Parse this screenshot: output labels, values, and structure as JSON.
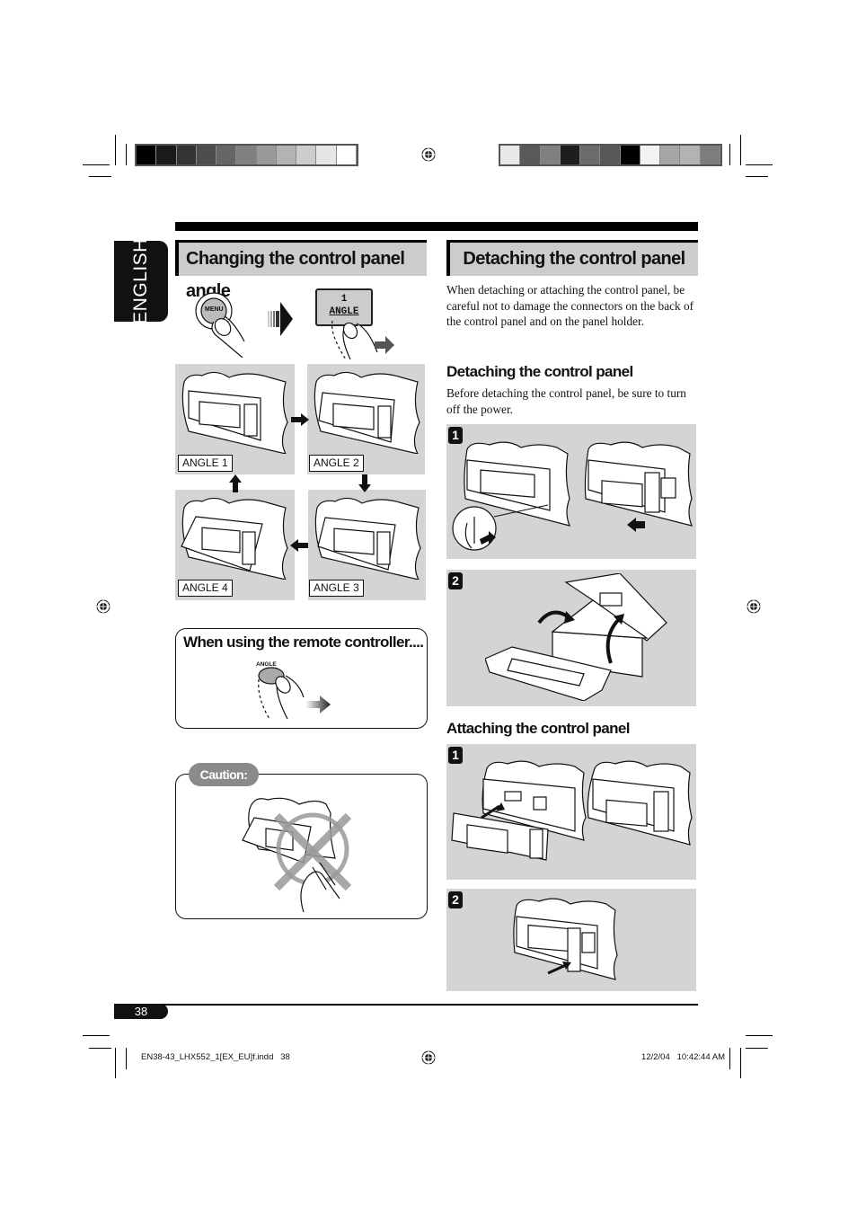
{
  "language_tab": "ENGLISH",
  "left_section": {
    "title": "Changing the control panel angle",
    "menu_button_label": "MENU",
    "display_number": "1",
    "display_label": "ANGLE",
    "angle_labels": [
      "ANGLE 1",
      "ANGLE 2",
      "ANGLE 3",
      "ANGLE 4"
    ],
    "remote_box": {
      "title": "When using the remote controller....",
      "button_label": "ANGLE"
    },
    "caution_label": "Caution:"
  },
  "right_section": {
    "title": "Detaching the control panel",
    "intro": "When detaching or attaching the control panel, be careful not to damage the connectors on the back of the control panel and on the panel holder.",
    "detaching": {
      "title": "Detaching the control panel",
      "text": "Before detaching the control panel, be sure to turn off the power.",
      "steps": [
        "1",
        "2"
      ]
    },
    "attaching": {
      "title": "Attaching the control panel",
      "steps": [
        "1",
        "2"
      ]
    }
  },
  "footer": {
    "page_number": "38",
    "file_name": "EN38-43_LHX552_1[EX_EU]f.indd   38",
    "timestamp": "12/2/04   10:42:44 AM"
  },
  "color_bars": {
    "left": [
      "#000000",
      "#1a1a1a",
      "#333333",
      "#4d4d4d",
      "#666666",
      "#808080",
      "#999999",
      "#b3b3b3",
      "#cccccc",
      "#e6e6e6",
      "#ffffff"
    ],
    "right": [
      "#e8e8e8",
      "#595959",
      "#808080",
      "#1e1e1e",
      "#6b6b6b",
      "#575757",
      "#000000",
      "#f2f2f2",
      "#a6a6a6",
      "#b3b3b3",
      "#7d7d7d"
    ]
  }
}
